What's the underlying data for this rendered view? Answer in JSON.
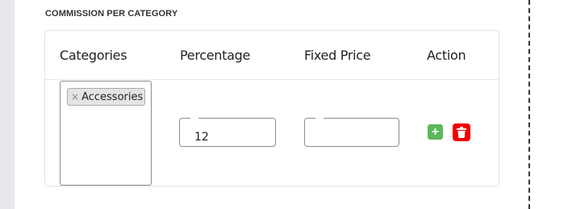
{
  "section": {
    "title": "COMMISSION PER CATEGORY"
  },
  "table": {
    "headers": {
      "categories": "Categories",
      "percentage": "Percentage",
      "fixed_price": "Fixed Price",
      "action": "Action"
    },
    "rows": [
      {
        "categories": [
          "Accessories"
        ],
        "remove_symbol": "×",
        "percentage": "12",
        "fixed_price": ""
      }
    ]
  },
  "icons": {
    "add": "plus-icon",
    "delete": "trash-icon"
  },
  "colors": {
    "add_button": "#5cb85c",
    "delete_button": "#f00000"
  }
}
